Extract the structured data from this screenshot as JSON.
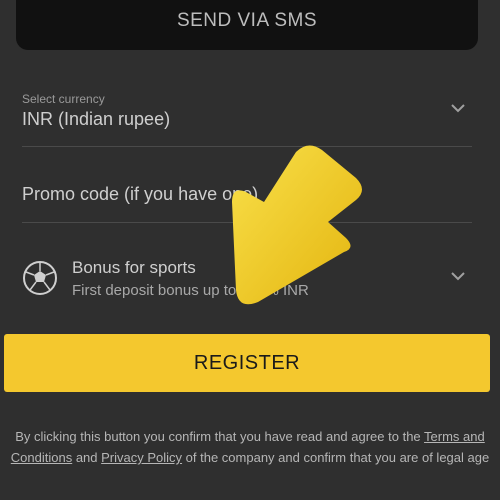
{
  "sms_button": {
    "label": "SEND VIA SMS"
  },
  "currency": {
    "caption": "Select currency",
    "value": "INR  (Indian rupee)"
  },
  "promo": {
    "placeholder": "Promo code (if you have one)"
  },
  "bonus": {
    "title": "Bonus for sports",
    "subtitle": "First deposit bonus up to 100% INR"
  },
  "register_button": {
    "label": "REGISTER"
  },
  "consent": {
    "text_before": "By clicking this button you confirm that you have read and agree to the",
    "terms_link": "Terms and Conditions",
    "and": " and ",
    "privacy_link": "Privacy Policy",
    "text_after": " of the company and confirm that you are of legal age"
  },
  "colors": {
    "background": "#2f2f2f",
    "accent": "#f4c82e",
    "sms_button_bg": "#111111"
  },
  "icons": {
    "currency_chevron": "chevron-down-icon",
    "bonus_ball": "soccer-ball-icon",
    "bonus_chevron": "chevron-down-icon",
    "overlay_arrow": "arrow-pointer-icon"
  }
}
